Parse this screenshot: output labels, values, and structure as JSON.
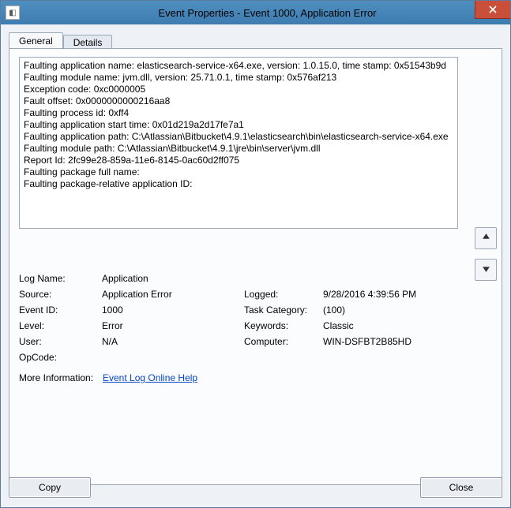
{
  "title": "Event Properties - Event 1000, Application Error",
  "tabs": {
    "general": "General",
    "details": "Details"
  },
  "detail_lines": [
    "Faulting application name: elasticsearch-service-x64.exe, version: 1.0.15.0, time stamp: 0x51543b9d",
    "Faulting module name: jvm.dll, version: 25.71.0.1, time stamp: 0x576af213",
    "Exception code: 0xc0000005",
    "Fault offset: 0x0000000000216aa8",
    "Faulting process id: 0xff4",
    "Faulting application start time: 0x01d219a2d17fe7a1",
    "Faulting application path: C:\\Atlassian\\Bitbucket\\4.9.1\\elasticsearch\\bin\\elasticsearch-service-x64.exe",
    "Faulting module path: C:\\Atlassian\\Bitbucket\\4.9.1\\jre\\bin\\server\\jvm.dll",
    "Report Id: 2fc99e28-859a-11e6-8145-0ac60d2ff075",
    "Faulting package full name:",
    "Faulting package-relative application ID:"
  ],
  "props": {
    "log_name_label": "Log Name:",
    "log_name": "Application",
    "source_label": "Source:",
    "source": "Application Error",
    "logged_label": "Logged:",
    "logged": "9/28/2016 4:39:56 PM",
    "event_id_label": "Event ID:",
    "event_id": "1000",
    "task_cat_label": "Task Category:",
    "task_cat": "(100)",
    "level_label": "Level:",
    "level": "Error",
    "keywords_label": "Keywords:",
    "keywords": "Classic",
    "user_label": "User:",
    "user": "N/A",
    "computer_label": "Computer:",
    "computer": "WIN-DSFBT2B85HD",
    "opcode_label": "OpCode:",
    "opcode": "",
    "more_info_label": "More Information:",
    "more_info_link": "Event Log Online Help"
  },
  "buttons": {
    "copy": "Copy",
    "close": "Close"
  },
  "icons": {
    "up": "arrow-up-icon",
    "down": "arrow-down-icon",
    "close_x": "close-icon"
  }
}
